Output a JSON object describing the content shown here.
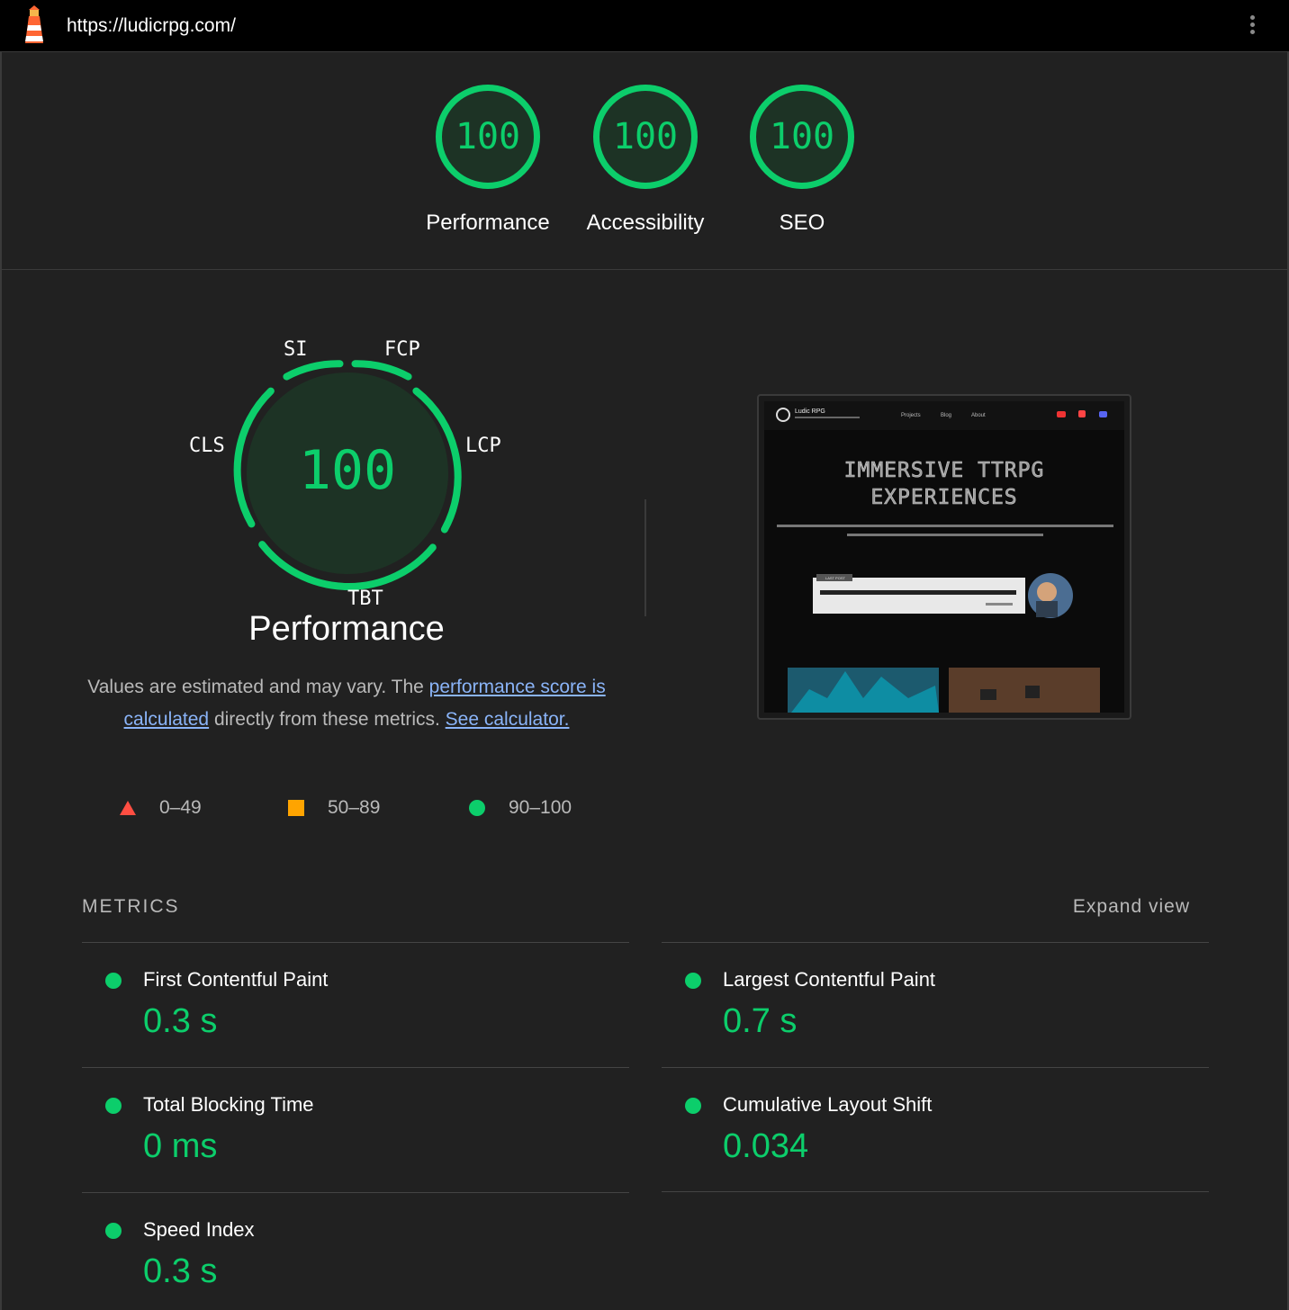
{
  "header": {
    "url": "https://ludicrpg.com/"
  },
  "categories": [
    {
      "score": "100",
      "label": "Performance"
    },
    {
      "score": "100",
      "label": "Accessibility"
    },
    {
      "score": "100",
      "label": "SEO"
    }
  ],
  "performance": {
    "score": "100",
    "title": "Performance",
    "metric_labels": {
      "si": "SI",
      "fcp": "FCP",
      "cls": "CLS",
      "lcp": "LCP",
      "tbt": "TBT"
    },
    "note_prefix": "Values are estimated and may vary. The ",
    "note_link1": "performance score is calculated",
    "note_middle": " directly from these metrics. ",
    "note_link2": "See calculator."
  },
  "legend": [
    {
      "range": "0–49",
      "color": "#ff4e42",
      "shape": "triangle"
    },
    {
      "range": "50–89",
      "color": "#ffa400",
      "shape": "square"
    },
    {
      "range": "90–100",
      "color": "#0cce6b",
      "shape": "circle"
    }
  ],
  "screenshot": {
    "site_name": "Ludic RPG",
    "nav": [
      "Projects",
      "Blog",
      "About"
    ],
    "headline_1": "IMMERSIVE TTRPG",
    "headline_2": "EXPERIENCES",
    "tag_label": "LAST POST"
  },
  "metrics": {
    "heading": "METRICS",
    "expand_label": "Expand view",
    "items": [
      {
        "name": "First Contentful Paint",
        "value": "0.3 s"
      },
      {
        "name": "Largest Contentful Paint",
        "value": "0.7 s"
      },
      {
        "name": "Total Blocking Time",
        "value": "0 ms"
      },
      {
        "name": "Cumulative Layout Shift",
        "value": "0.034"
      },
      {
        "name": "Speed Index",
        "value": "0.3 s"
      }
    ]
  },
  "colors": {
    "pass": "#0cce6b",
    "average": "#ffa400",
    "fail": "#ff4e42",
    "link": "#8ab4f8"
  }
}
